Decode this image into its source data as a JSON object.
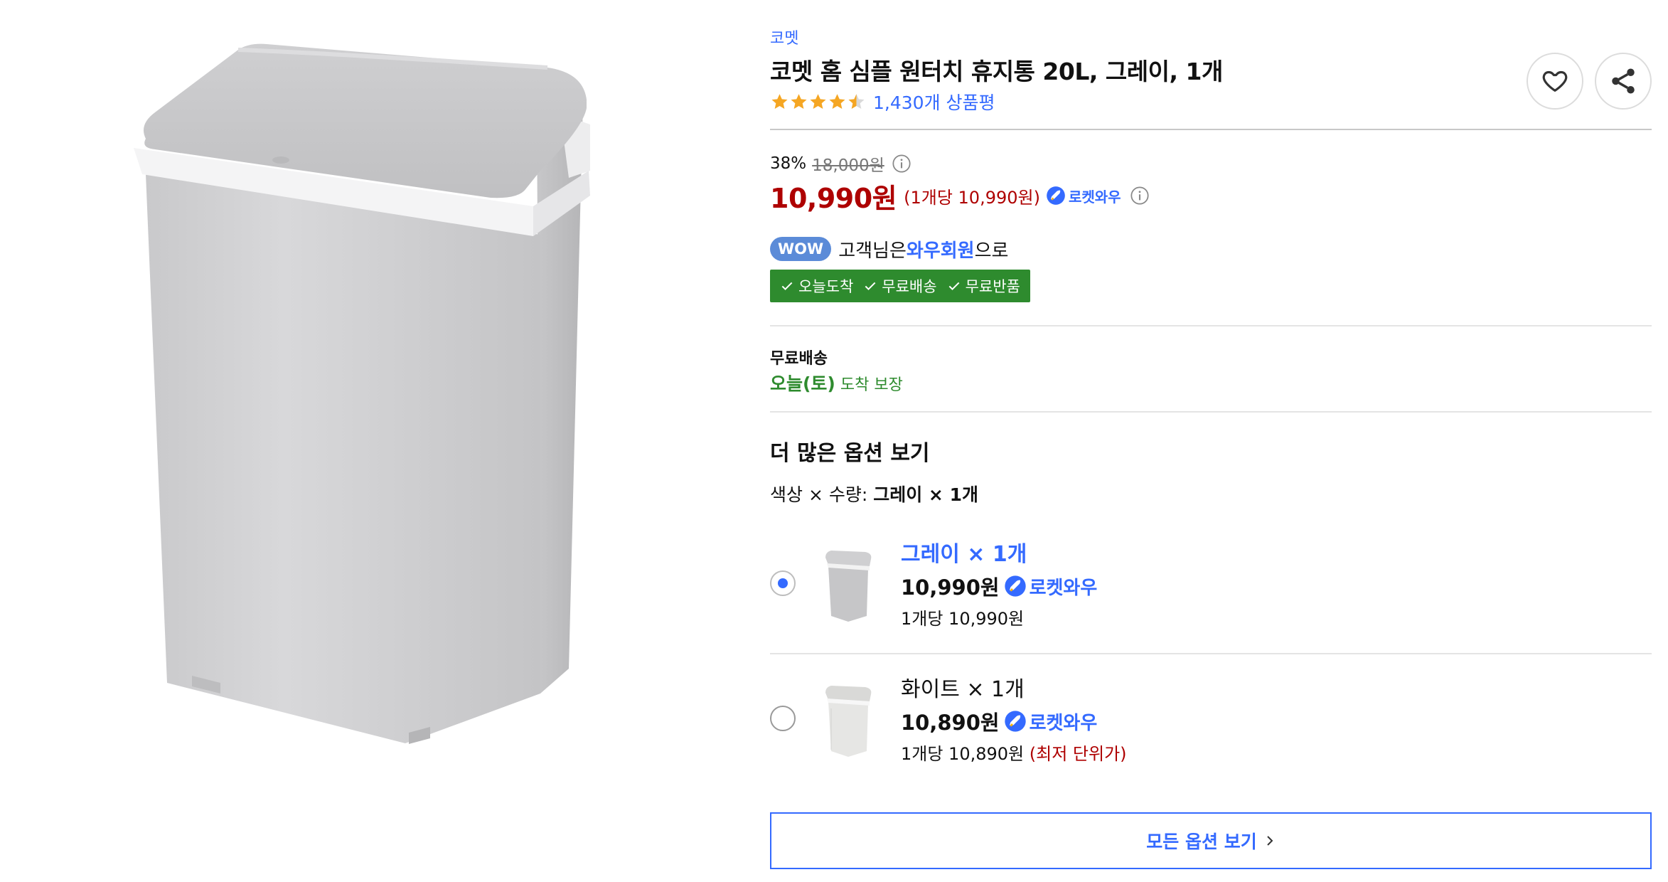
{
  "product": {
    "brand": "코멧",
    "title": "코멧 홈 심플 원터치 휴지통 20L, 그레이, 1개",
    "rating": 4.5,
    "review_count": "1,430개 상품평"
  },
  "pricing": {
    "discount_rate": "38%",
    "original_price": "18,000원",
    "sale_price": "10,990원",
    "unit_price": "(1개당 10,990원)",
    "rocket_label": "로켓와우"
  },
  "wow": {
    "badge": "WOW",
    "text_before": "고객님은 ",
    "link": "와우회원",
    "text_after": "으로"
  },
  "benefits": [
    "오늘도착",
    "무료배송",
    "무료반품"
  ],
  "shipping": {
    "label": "무료배송",
    "arrival_day": "오늘(토)",
    "arrival_suffix": " 도착 보장"
  },
  "options": {
    "heading": "더 많은 옵션 보기",
    "summary_label": "색상 × 수량: ",
    "summary_value": "그레이 × 1개",
    "items": [
      {
        "name": "그레이 × 1개",
        "price": "10,990원",
        "badge": "로켓와우",
        "unit": "1개당 10,990원",
        "lowest": "",
        "selected": true
      },
      {
        "name": "화이트 × 1개",
        "price": "10,890원",
        "badge": "로켓와우",
        "unit": "1개당 10,890원",
        "lowest": "(최저 단위가)",
        "selected": false
      }
    ],
    "all_button": "모든 옵션 보기"
  },
  "colors": {
    "accent_blue": "#346aff",
    "sale_red": "#ae0000",
    "benefit_green": "#2e8b2e",
    "star_orange": "#f5a623"
  }
}
